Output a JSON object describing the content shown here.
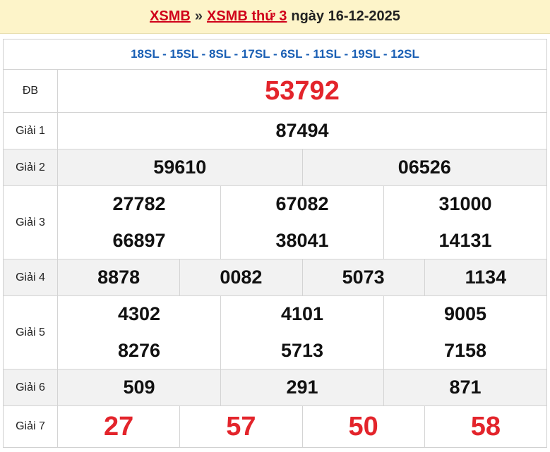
{
  "header": {
    "link1": "XSMB",
    "separator": "»",
    "link2": "XSMB thứ 3",
    "date_text": "ngày 16-12-2025"
  },
  "codes": "18SL - 15SL - 8SL - 17SL - 6SL - 11SL - 19SL - 12SL",
  "prizes": {
    "db": {
      "label": "ĐB",
      "numbers": [
        "53792"
      ]
    },
    "g1": {
      "label": "Giải 1",
      "numbers": [
        "87494"
      ]
    },
    "g2": {
      "label": "Giải 2",
      "numbers": [
        "59610",
        "06526"
      ]
    },
    "g3": {
      "label": "Giải 3",
      "numbers": [
        "27782",
        "67082",
        "31000",
        "66897",
        "38041",
        "14131"
      ]
    },
    "g4": {
      "label": "Giải 4",
      "numbers": [
        "8878",
        "0082",
        "5073",
        "1134"
      ]
    },
    "g5": {
      "label": "Giải 5",
      "numbers": [
        "4302",
        "4101",
        "9005",
        "8276",
        "5713",
        "7158"
      ]
    },
    "g6": {
      "label": "Giải 6",
      "numbers": [
        "509",
        "291",
        "871"
      ]
    },
    "g7": {
      "label": "Giải 7",
      "numbers": [
        "27",
        "57",
        "50",
        "58"
      ]
    }
  },
  "colors": {
    "accent_red": "#e3242b",
    "code_blue": "#1a5fb4",
    "header_bg": "#fdf4c9"
  }
}
